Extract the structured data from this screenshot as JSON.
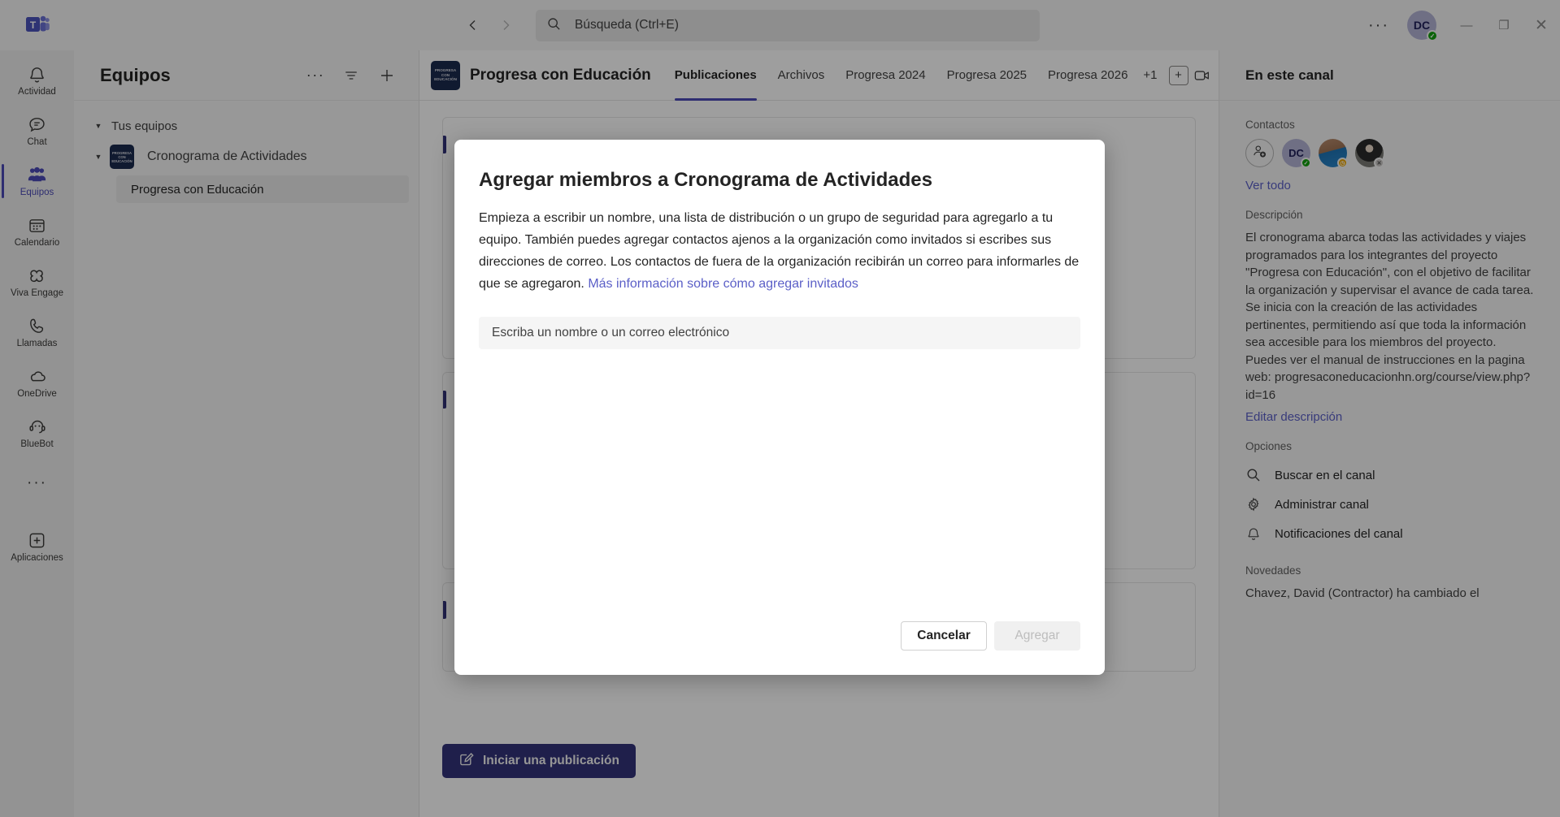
{
  "titlebar": {
    "back_icon": "chevron-left-icon",
    "forward_icon": "chevron-right-icon",
    "search_placeholder": "Búsqueda (Ctrl+E)",
    "more_label": "···",
    "avatar_initials": "DC",
    "minimize_label": "—",
    "maximize_label": "❐",
    "close_label": "✕"
  },
  "rail": {
    "items": [
      {
        "label": "Actividad",
        "icon": "bell-icon"
      },
      {
        "label": "Chat",
        "icon": "chat-icon"
      },
      {
        "label": "Equipos",
        "icon": "people-icon"
      },
      {
        "label": "Calendario",
        "icon": "calendar-icon"
      },
      {
        "label": "Viva Engage",
        "icon": "viva-engage-icon"
      },
      {
        "label": "Llamadas",
        "icon": "phone-icon"
      },
      {
        "label": "OneDrive",
        "icon": "cloud-icon"
      },
      {
        "label": "BlueBot",
        "icon": "bot-icon"
      }
    ],
    "more_label": "···",
    "apps_label": "Aplicaciones",
    "apps_icon": "plus-box-icon"
  },
  "teams_pane": {
    "title": "Equipos",
    "actions": [
      {
        "name": "more-options",
        "icon": "ellipsis-icon",
        "label": "···"
      },
      {
        "name": "filter",
        "icon": "filter-icon"
      },
      {
        "name": "add-team",
        "icon": "plus-icon"
      }
    ],
    "group_label": "Tus equipos",
    "team_name": "Cronograma de Actividades",
    "team_avatar_text": "PROGRESA CON EDUCACIÓN",
    "channel_name": "Progresa con Educación"
  },
  "channel_header": {
    "avatar_text": "PROGRESA CON EDUCACIÓN",
    "title": "Progresa con Educación",
    "tabs": [
      {
        "label": "Publicaciones",
        "active": true
      },
      {
        "label": "Archivos",
        "active": false
      },
      {
        "label": "Progresa 2024",
        "active": false
      },
      {
        "label": "Progresa 2025",
        "active": false
      },
      {
        "label": "Progresa 2026",
        "active": false
      }
    ],
    "overflow_label": "+1",
    "add_tab_label": "+",
    "meet_icon": "video-camera-icon",
    "meet_chevron": "chevron-down-icon",
    "more_icon": "ellipsis-icon",
    "more_label": "···",
    "panel_icon": "open-panel-icon"
  },
  "main": {
    "start_post_label": "Iniciar una publicación",
    "start_post_icon": "compose-icon"
  },
  "right_panel": {
    "title": "En este canal",
    "contacts_label": "Contactos",
    "add_contact_icon": "person-add-icon",
    "contacts": [
      {
        "initials": "DC",
        "bg": "#b4b4d6",
        "fg": "#21215b",
        "status": "available",
        "status_color": "#13a10e",
        "status_glyph": "✓"
      },
      {
        "initials": "",
        "bg": "#2a6496",
        "fg": "#ffffff",
        "status": "away",
        "status_color": "#eaa300",
        "status_glyph": "◷"
      },
      {
        "initials": "",
        "bg": "#4a4a4a",
        "fg": "#ffffff",
        "status": "offline",
        "status_color": "#8a8886",
        "status_glyph": "✕"
      }
    ],
    "see_all_label": "Ver todo",
    "description_label": "Descripción",
    "description_text": "El cronograma abarca todas las actividades y viajes programados para los integrantes del proyecto \"Progresa con Educación\", con el objetivo de facilitar la organización y supervisar el avance de cada tarea. Se inicia con la creación de las actividades pertinentes, permitiendo así que toda la información sea accesible para los miembros del proyecto. Puedes ver el manual de instrucciones en la pagina web: progresaconeducacionhn.org/course/view.php?id=16",
    "edit_description_label": "Editar descripción",
    "options_label": "Opciones",
    "options": [
      {
        "label": "Buscar en el canal",
        "icon": "search-icon"
      },
      {
        "label": "Administrar canal",
        "icon": "gear-icon"
      },
      {
        "label": "Notificaciones del canal",
        "icon": "bell-icon"
      }
    ],
    "news_label": "Novedades",
    "news_text": "Chavez, David (Contractor) ha cambiado el"
  },
  "modal": {
    "title": "Agregar miembros a Cronograma de Actividades",
    "description_part1": "Empieza a escribir un nombre, una lista de distribución o un grupo de seguridad para agregarlo a tu equipo. También puedes agregar contactos ajenos a la organización como invitados si escribes sus direcciones de correo. Los contactos de fuera de la organización recibirán un correo para informarles de que se agregaron. ",
    "link_text": "Más información sobre cómo agregar invitados",
    "input_placeholder": "Escriba un nombre o un correo electrónico",
    "input_value": "",
    "cancel_label": "Cancelar",
    "add_label": "Agregar"
  },
  "colors": {
    "accent": "#4b49b6",
    "link": "#5b5fc7",
    "brand_dark": "#33337a",
    "team_avatar": "#1b2a4e",
    "available": "#13a10e",
    "away": "#eaa300"
  }
}
